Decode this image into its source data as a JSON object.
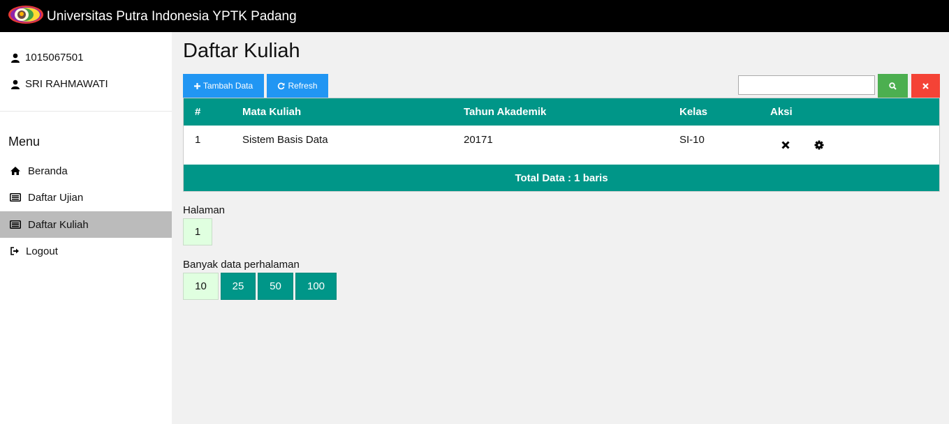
{
  "app": {
    "title": "Universitas Putra Indonesia YPTK Padang",
    "logo_icon": "university-logo"
  },
  "sidebar": {
    "user_id": "1015067501",
    "user_name": "SRI RAHMAWATI",
    "menu_title": "Menu",
    "items": [
      {
        "label": "Beranda",
        "icon": "home-icon",
        "active": false
      },
      {
        "label": "Daftar Ujian",
        "icon": "list-icon",
        "active": false
      },
      {
        "label": "Daftar Kuliah",
        "icon": "list-icon",
        "active": true
      },
      {
        "label": "Logout",
        "icon": "logout-icon",
        "active": false
      }
    ]
  },
  "main": {
    "title": "Daftar Kuliah",
    "toolbar": {
      "add_label": "Tambah Data",
      "refresh_label": "Refresh",
      "search_value": "",
      "search_placeholder": ""
    },
    "table": {
      "headers": [
        "#",
        "Mata Kuliah",
        "Tahun Akademik",
        "Kelas",
        "Aksi"
      ],
      "rows": [
        {
          "no": "1",
          "mata_kuliah": "Sistem Basis Data",
          "tahun": "20171",
          "kelas": "SI-10"
        }
      ],
      "footer": "Total Data : 1 baris"
    },
    "pagination": {
      "label": "Halaman",
      "pages": [
        "1"
      ],
      "current": "1"
    },
    "per_page": {
      "label": "Banyak data perhalaman",
      "options": [
        "10",
        "25",
        "50",
        "100"
      ],
      "current": "10"
    }
  },
  "colors": {
    "teal": "#009688",
    "blue": "#2196f3",
    "green": "#4caf50",
    "red": "#f44336",
    "active_bg": "#bbbbbb",
    "light_green": "#e0ffe0"
  }
}
